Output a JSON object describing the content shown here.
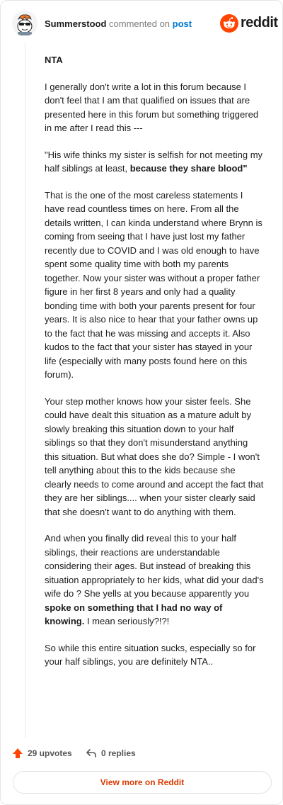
{
  "header": {
    "username": "Summerstood",
    "action": "commented on",
    "target": "post",
    "brand": "reddit"
  },
  "comment": {
    "p1": "NTA",
    "p2": "I generally don't write a lot in this forum because I don't feel that I am that qualified on issues that are presented here in this forum but something triggered in me after I read this ---",
    "p3_plain": "\"His wife thinks my sister is selfish for not meeting my half siblings at least, ",
    "p3_bold": "because they share blood\"",
    "p4": "That is the one of the most careless statements I have read countless times on here. From all the details written, I can kinda understand where Brynn is coming from seeing that I have just lost my father recently due to COVID and I was old enough to have spent some quality time with both my parents together. Now your sister was without a proper father figure in her first 8 years and only had a quality bonding time with both your parents present for four years. It is also nice to hear that your father owns up to the fact that he was missing and accepts it. Also kudos to the fact that your sister has stayed in your life (especially with many posts found here on this forum).",
    "p5": "Your step mother knows how your sister feels. She could have dealt this situation as a mature adult by slowly breaking this situation down to your half siblings so that they don't misunderstand anything this situation. But what does she do? Simple - I won't tell anything about this to the kids because she clearly needs to come around and accept the fact that they are her siblings.... when your sister clearly said that she doesn't want to do anything with them.",
    "p6_plain": "And when you finally did reveal this to your half siblings, their reactions are understandable considering their ages. But instead of breaking this situation appropriately to her kids, what did your dad's wife do ? She yells at you because apparently you ",
    "p6_bold": "spoke on something that I had no way of knowing.",
    "p6_tail": " I mean seriously?!?!",
    "p7": "So while this entire situation sucks, especially so for your half siblings, you are definitely NTA.."
  },
  "footer": {
    "upvotes": "29 upvotes",
    "replies": "0 replies",
    "more": "View more on Reddit"
  },
  "colors": {
    "accent": "#d93a00",
    "link": "#0079d3",
    "upvote": "#ff4500"
  },
  "icons": {
    "avatar": "snoo-avatar-with-sunglasses",
    "logo": "reddit-snoo-icon",
    "upvote": "upvote-arrow-icon",
    "reply": "reply-arrow-icon"
  }
}
